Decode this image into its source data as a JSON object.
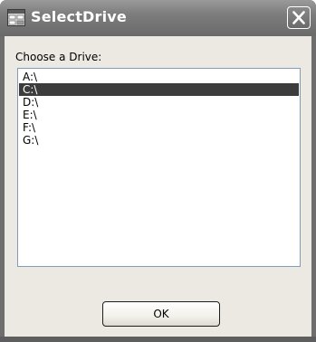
{
  "window": {
    "title": "SelectDrive",
    "icon": "form-window-icon",
    "close_icon": "close-x-icon"
  },
  "dialog": {
    "prompt_label": "Choose a Drive:",
    "drives": [
      {
        "label": "A:\\",
        "selected": false
      },
      {
        "label": "C:\\",
        "selected": true
      },
      {
        "label": "D:\\",
        "selected": false
      },
      {
        "label": "E:\\",
        "selected": false
      },
      {
        "label": "F:\\",
        "selected": false
      },
      {
        "label": "G:\\",
        "selected": false
      }
    ],
    "ok_label": "OK"
  },
  "colors": {
    "titlebar": "#7c7c7c",
    "client_background": "#ece9e2",
    "selection_background": "#3c3c3c",
    "selection_text": "#ffffff"
  }
}
